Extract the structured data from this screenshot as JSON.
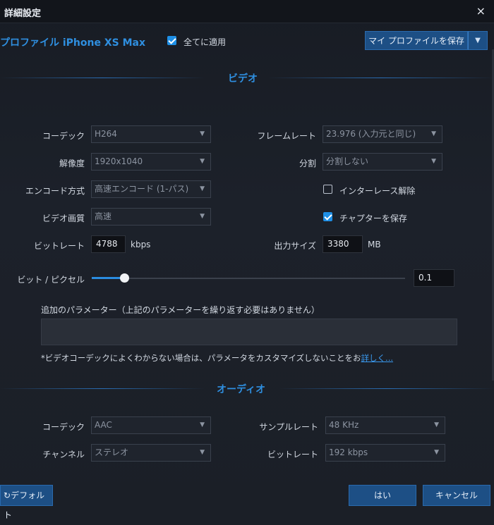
{
  "window": {
    "title": "詳細設定",
    "close": "×"
  },
  "header": {
    "profile": "プロファイル iPhone XS Max",
    "apply_all_label": "全てに適用",
    "apply_all_checked": true,
    "save_profile_label": "マイ プロファイルを保存",
    "save_profile_arrow": "▼"
  },
  "video": {
    "section_title": "ビデオ",
    "codec": {
      "label": "コーデック",
      "value": "H264"
    },
    "framerate": {
      "label": "フレームレート",
      "value": "23.976 (入力元と同じ)"
    },
    "resolution": {
      "label": "解像度",
      "value": "1920x1040"
    },
    "split": {
      "label": "分割",
      "value": "分割しない"
    },
    "encode": {
      "label": "エンコード方式",
      "value": "高速エンコード (1-パス)"
    },
    "deinterlace": {
      "label": "インターレース解除",
      "checked": false
    },
    "quality": {
      "label": "ビデオ画質",
      "value": "高速"
    },
    "save_chapters": {
      "label": "チャプターを保存",
      "checked": true
    },
    "bitrate": {
      "label": "ビットレート",
      "value": "4788",
      "unit": "kbps"
    },
    "output_size": {
      "label": "出力サイズ",
      "value": "3380",
      "unit": "MB"
    },
    "bits_per_pixel": {
      "label": "ビット / ピクセル",
      "value": "0.1",
      "slider_fraction": 0.1
    },
    "extra_params_label": "追加のパラメーター（上記のパラメーターを繰り返す必要はありません）",
    "extra_params_value": "",
    "note": "*ビデオコーデックによくわからない場合は、パラメータをカスタマイズしないことをお",
    "note_link": "詳しく..."
  },
  "audio": {
    "section_title": "オーディオ",
    "codec": {
      "label": "コーデック",
      "value": "AAC"
    },
    "sample_rate": {
      "label": "サンプルレート",
      "value": "48 KHz"
    },
    "channel": {
      "label": "チャンネル",
      "value": "ステレオ"
    },
    "bitrate": {
      "label": "ビットレート",
      "value": "192 kbps"
    }
  },
  "footer": {
    "default_label": "デフォルト",
    "ok_label": "はい",
    "cancel_label": "キャンセル"
  },
  "colors": {
    "accent": "#2f8fe0",
    "button": "#1d4f85",
    "background": "#1b1f27"
  }
}
